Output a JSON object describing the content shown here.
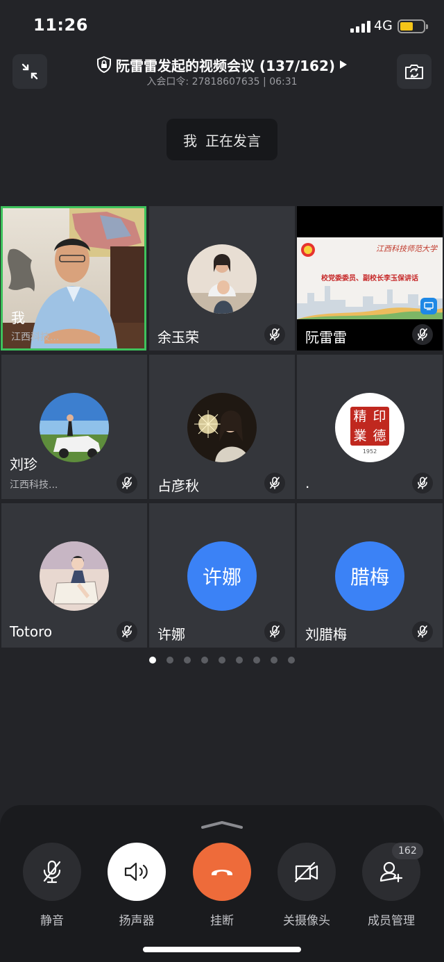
{
  "status_bar": {
    "time": "11:26",
    "network": "4G"
  },
  "header": {
    "title": "阮雷雷发起的视频会议 (137/162)",
    "meeting_code_label": "入会口令:",
    "meeting_code": "27818607635",
    "separator": "|",
    "duration": "06:31"
  },
  "speaking": {
    "who": "我",
    "status": "正在发言"
  },
  "participants": [
    {
      "name": "我",
      "org": "江西科技...",
      "muted": false,
      "active": true
    },
    {
      "name": "余玉荣",
      "muted": true
    },
    {
      "name": "阮雷雷",
      "muted": true,
      "share_banner": "校党委委员、副校长李玉保讲话",
      "share_school": "江西科技师范大学"
    },
    {
      "name": "刘珍",
      "org": "江西科技...",
      "muted": true
    },
    {
      "name": "占彦秋",
      "muted": true
    },
    {
      "name": ".",
      "muted": true,
      "seal_text": [
        "精",
        "印",
        "業",
        "德"
      ],
      "seal_year": "1952"
    },
    {
      "name": "Totoro",
      "muted": true
    },
    {
      "name": "许娜",
      "avatar_text": "许娜",
      "muted": true
    },
    {
      "name": "刘腊梅",
      "avatar_text": "腊梅",
      "muted": true
    }
  ],
  "pagination": {
    "total": 9,
    "current": 1
  },
  "controls": {
    "mute": "静音",
    "speaker": "扬声器",
    "hangup": "挂断",
    "camera_off": "关摄像头",
    "members": "成员管理",
    "members_count": "162"
  },
  "colors": {
    "active_border": "#3ec25c",
    "hangup": "#ee6b3a",
    "avatar_blue": "#3b82f6",
    "battery": "#f5c518"
  }
}
